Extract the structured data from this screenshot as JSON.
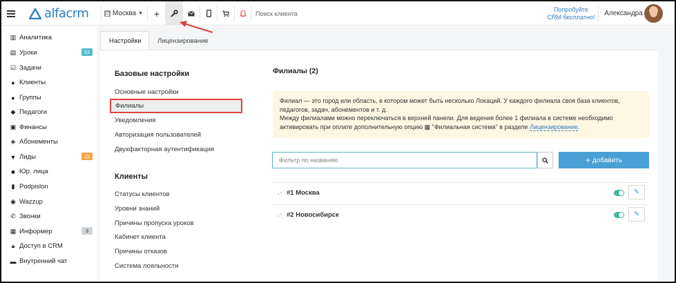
{
  "topbar": {
    "logo_text": "alfacrm",
    "city": "Москва",
    "search_placeholder": "Поиск клиента",
    "trial_line1": "Попробуйте",
    "trial_line2": "CRM бесплатно!",
    "user_name": "Александра"
  },
  "sidebar": {
    "items": [
      {
        "label": "Аналитика",
        "icon": "chart-icon"
      },
      {
        "label": "Уроки",
        "icon": "calendar-icon",
        "badge": "53"
      },
      {
        "label": "Задачи",
        "icon": "checklist-icon"
      },
      {
        "label": "Клиенты",
        "icon": "user-icon"
      },
      {
        "label": "Группы",
        "icon": "users-icon"
      },
      {
        "label": "Педагоги",
        "icon": "graduation-cap-icon"
      },
      {
        "label": "Финансы",
        "icon": "money-icon"
      },
      {
        "label": "Абонементы",
        "icon": "ticket-icon"
      },
      {
        "label": "Лиды",
        "icon": "funnel-icon",
        "badge": "22"
      },
      {
        "label": "Юр. лица",
        "icon": "briefcase-icon"
      },
      {
        "label": "Podpislon",
        "icon": "document-icon"
      },
      {
        "label": "Wazzup",
        "icon": "whatsapp-icon"
      },
      {
        "label": "Звонки",
        "icon": "phone-icon"
      },
      {
        "label": "Информер",
        "icon": "informer-icon",
        "badge": "3"
      },
      {
        "label": "Доступ в CRM",
        "icon": "lock-icon"
      },
      {
        "label": "Внутренний чат",
        "icon": "chat-icon"
      }
    ]
  },
  "tabs": {
    "settings": "Настройки",
    "licensing": "Лицензирование"
  },
  "menu": {
    "basic_title": "Базовые настройки",
    "basic_items": [
      "Основные настройки",
      "Филиалы",
      "Уведомления",
      "Авторизация пользователей",
      "Двухфакторная аутентификация"
    ],
    "clients_title": "Клиенты",
    "client_items": [
      "Статусы клиентов",
      "Уровни знаний",
      "Причины пропуска уроков",
      "Кабинет клиента",
      "Причины отказов",
      "Система лояльности"
    ]
  },
  "main": {
    "title": "Филиалы (2)",
    "info_line1": "Филиал — это город или область, в котором может быть несколько Локаций. У каждого филиала своя база клиентов,",
    "info_line2": "педагогов, задач, абонементов и т. д.",
    "info_line3": "Между филиалами можно переключаться в верхней панели. Для ведения более 1 филиала в системе необходимо",
    "info_line4_prefix": "активировать при оплате дополнительную опцию",
    "info_line4_option": "\"Филиальная система\" в разделе",
    "info_link": "Лицензирование",
    "info_end": ".",
    "filter_placeholder": "Фильтр по названию",
    "add_label": "добавить",
    "branches": [
      {
        "label": "#1 Москва",
        "enabled": true
      },
      {
        "label": "#2 Новосибирск",
        "enabled": true
      }
    ]
  },
  "colors": {
    "brand_blue": "#2d7fc4",
    "add_button": "#4a9fd5",
    "toggle_on": "#44b8a0",
    "highlight_border": "#e04141",
    "info_bg": "#fdf6e3"
  }
}
